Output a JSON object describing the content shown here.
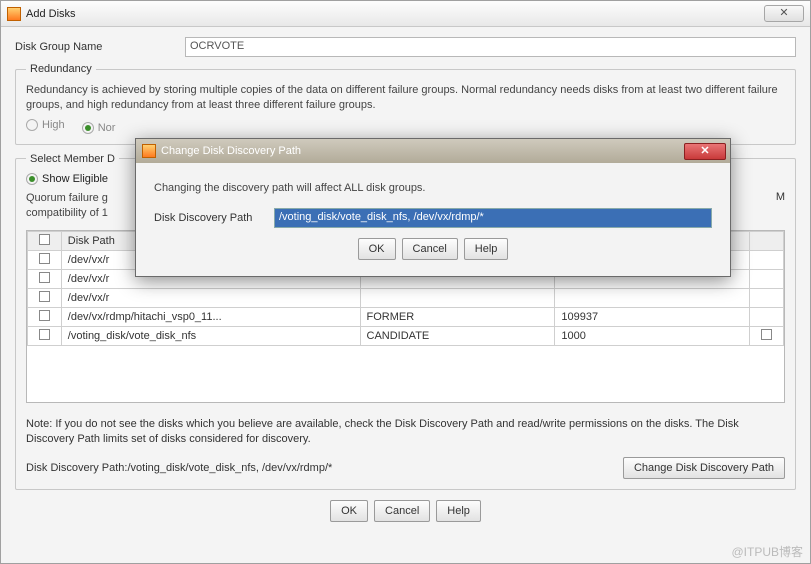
{
  "window": {
    "title": "Add Disks",
    "close_glyph": "✕"
  },
  "form": {
    "disk_group_label": "Disk Group Name",
    "disk_group_value": "OCRVOTE"
  },
  "redundancy": {
    "legend": "Redundancy",
    "desc": "Redundancy is achieved by storing multiple copies of the data on different failure groups. Normal redundancy needs disks from at least two different failure groups, and high redundancy from at least three different failure groups.",
    "opt_high": "High",
    "opt_normal": "Nor"
  },
  "select": {
    "legend": "Select Member D",
    "show_eligible": "Show Eligible",
    "quorum_text": "Quorum failure g\ncompatibility of 1",
    "trailing": "M",
    "headers": {
      "chk": "",
      "diskpath": "Disk Path",
      "status": "",
      "size": "",
      "q": ""
    },
    "rows": [
      {
        "path": "/dev/vx/r",
        "status": "",
        "size": "",
        "q": ""
      },
      {
        "path": "/dev/vx/r",
        "status": "",
        "size": "",
        "q": ""
      },
      {
        "path": "/dev/vx/r",
        "status": "",
        "size": "",
        "q": ""
      },
      {
        "path": "/dev/vx/rdmp/hitachi_vsp0_11...",
        "status": "FORMER",
        "size": "109937",
        "q": ""
      },
      {
        "path": "/voting_disk/vote_disk_nfs",
        "status": "CANDIDATE",
        "size": "1000",
        "q": ""
      }
    ],
    "note": "Note: If you do not see the disks which you believe are available, check the Disk Discovery Path and read/write permissions on the disks. The Disk Discovery Path limits set of disks considered for discovery.",
    "path_label": "Disk Discovery Path:/voting_disk/vote_disk_nfs, /dev/vx/rdmp/*",
    "change_btn": "Change Disk Discovery Path"
  },
  "buttons": {
    "ok": "OK",
    "cancel": "Cancel",
    "help": "Help"
  },
  "modal": {
    "title": "Change Disk Discovery Path",
    "close": "✕",
    "warn": "Changing the discovery path will affect ALL disk groups.",
    "label": "Disk Discovery Path",
    "value": "/voting_disk/vote_disk_nfs, /dev/vx/rdmp/*",
    "ok": "OK",
    "cancel": "Cancel",
    "help": "Help"
  },
  "watermark": "@ITPUB博客"
}
